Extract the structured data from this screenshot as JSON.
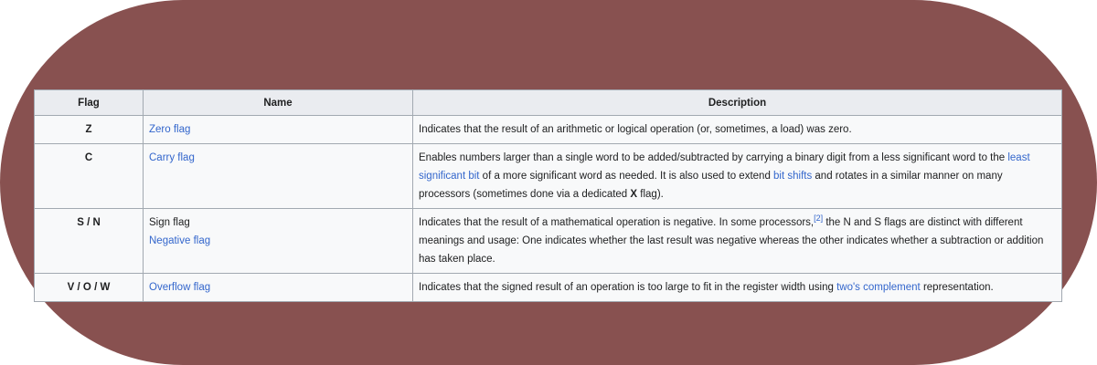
{
  "table": {
    "headers": {
      "flag": "Flag",
      "name": "Name",
      "description": "Description"
    },
    "rows": [
      {
        "flag": "Z",
        "name": "Zero flag",
        "description": "Indicates that the result of an arithmetic or logical operation (or, sometimes, a load) was zero."
      },
      {
        "flag": "C",
        "name": "Carry flag",
        "desc_part1": "Enables numbers larger than a single word to be added/subtracted by carrying a binary digit from a less significant word to the ",
        "desc_link1": "least significant bit",
        "desc_part2": " of a more significant word as needed. It is also used to extend ",
        "desc_link2": "bit shifts",
        "desc_part3": " and rotates in a similar manner on many processors (sometimes done via a dedicated ",
        "desc_bold": "X",
        "desc_part4": " flag)."
      },
      {
        "flag": "S / N",
        "name_line1": "Sign flag",
        "name_line2": "Negative flag",
        "desc_part1": "Indicates that the result of a mathematical operation is negative. In some processors,",
        "desc_ref": "[2]",
        "desc_part2": " the N and S flags are distinct with different meanings and usage: One indicates whether the last result was negative whereas the other indicates whether a subtraction or addition has taken place."
      },
      {
        "flag": "V / O / W",
        "name": "Overflow flag",
        "desc_part1": "Indicates that the signed result of an operation is too large to fit in the register width using ",
        "desc_link1": "two's complement",
        "desc_part2": " representation."
      }
    ]
  },
  "colors": {
    "background": "#885150",
    "link": "#3366cc",
    "header_bg": "#eaecf0",
    "cell_bg": "#f8f9fa",
    "border": "#a2a9b1"
  }
}
